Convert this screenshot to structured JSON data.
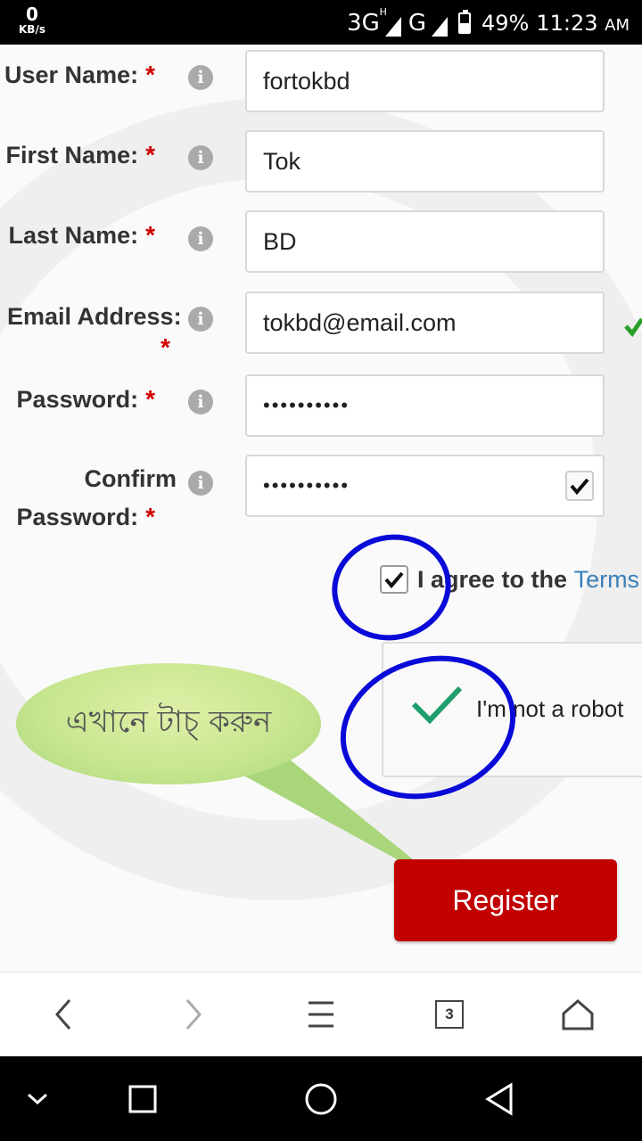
{
  "status_bar": {
    "speed_value": "0",
    "speed_unit": "KB/s",
    "network_1": "3G",
    "network_1_sup": "H",
    "network_2": "G",
    "battery": "49%",
    "battery_level": 0.49,
    "time": "11:23",
    "ampm": "AM"
  },
  "form": {
    "username": {
      "label": "User Name:",
      "required": "*",
      "value": "fortokbd"
    },
    "firstname": {
      "label": "First Name:",
      "required": "*",
      "value": "Tok"
    },
    "lastname": {
      "label": "Last Name:",
      "required": "*",
      "value": "BD"
    },
    "email": {
      "label": "Email Address:",
      "required": "*",
      "value": "tokbd@email.com"
    },
    "password": {
      "label": "Password:",
      "required": "*",
      "value": "••••••••••"
    },
    "confirm": {
      "label_line1": "Confirm",
      "label_line2": "Password:",
      "required": "*",
      "value": "••••••••••"
    },
    "info_glyph": "i",
    "terms": {
      "text": "I agree to the",
      "link": "Terms"
    },
    "recaptcha": {
      "label": "I'm not a robot"
    },
    "register_label": "Register"
  },
  "annotation": {
    "bubble_text": "এখানে টাচ্ করুন",
    "bubble_color": "#c8e690",
    "circle_color": "#0a0ad8"
  },
  "browser_bar": {
    "back_icon": "chevron-left-icon",
    "forward_icon": "chevron-right-icon",
    "menu_icon": "menu-icon",
    "tabs_count": "3",
    "home_icon": "home-icon"
  },
  "colors": {
    "register_bg": "#c10000",
    "required_star": "#d30000",
    "link": "#3a7fb8",
    "recaptcha_check": "#1e9e6a"
  }
}
